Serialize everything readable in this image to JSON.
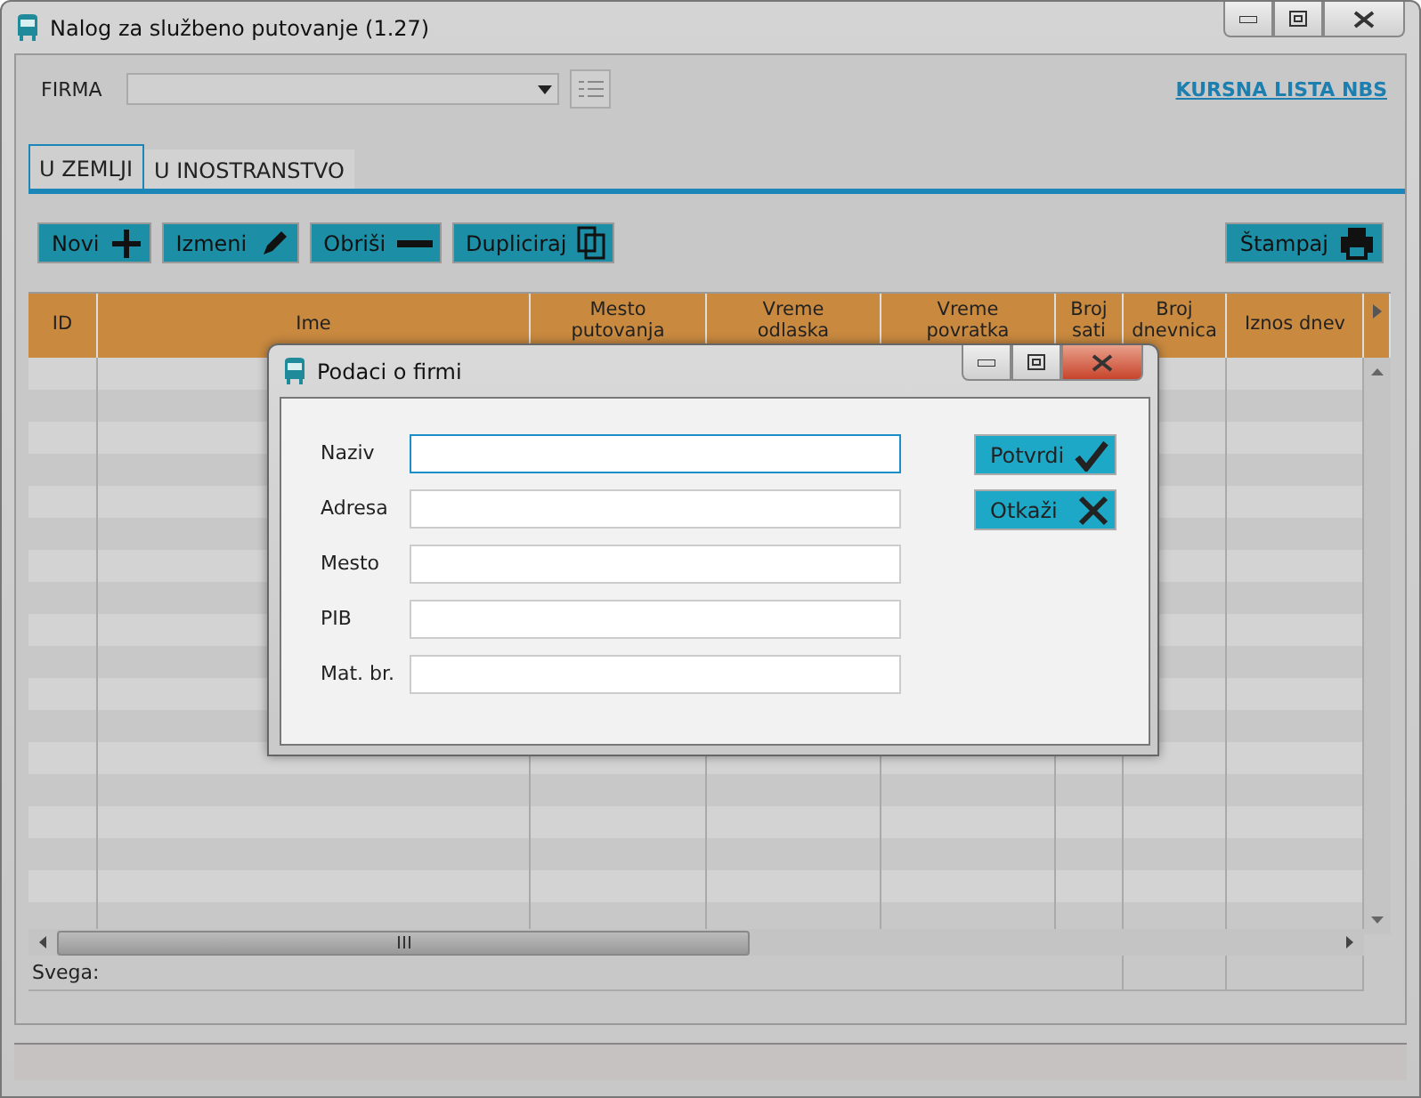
{
  "window": {
    "title": "Nalog za službeno putovanje (1.27)"
  },
  "firma": {
    "label": "FIRMA"
  },
  "link": "KURSNA LISTA NBS",
  "tabs": [
    {
      "label": "U ZEMLJI",
      "selected": true
    },
    {
      "label": "U INOSTRANSTVO",
      "selected": false
    }
  ],
  "toolbar": [
    {
      "label": "Novi",
      "kind": "plus"
    },
    {
      "label": "Izmeni",
      "kind": "pencil"
    },
    {
      "label": "Obriši",
      "kind": "minus"
    },
    {
      "label": "Dupliciraj",
      "kind": "copy"
    }
  ],
  "print_button": {
    "label": "Štampaj"
  },
  "table": {
    "columns": [
      "ID",
      "Ime",
      "Mesto putovanja",
      "Vreme odlaska",
      "Vreme povratka",
      "Broj sati",
      "Broj dnevnica",
      "Iznos dnev"
    ]
  },
  "footer": {
    "label": "Svega:"
  },
  "dialog": {
    "title": "Podaci o firmi",
    "fields": [
      {
        "label": "Naziv",
        "focused": true
      },
      {
        "label": "Adresa",
        "focused": false
      },
      {
        "label": "Mesto",
        "focused": false
      },
      {
        "label": "PIB",
        "focused": false
      },
      {
        "label": "Mat. br.",
        "focused": false
      }
    ],
    "buttons": [
      {
        "label": "Potvrdi",
        "kind": "ok"
      },
      {
        "label": "Otkaži",
        "kind": "cancel"
      }
    ]
  }
}
